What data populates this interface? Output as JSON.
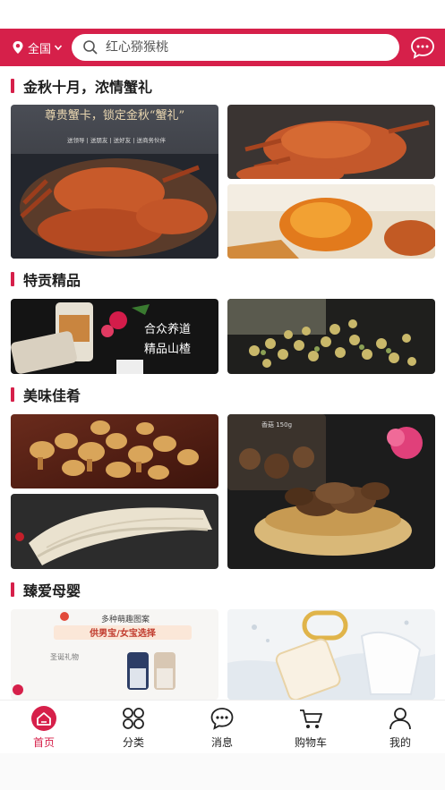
{
  "header": {
    "location_label": "全国",
    "search_placeholder": "红心猕猴桃"
  },
  "sections": [
    {
      "title": "金秋十月，浓情蟹礼",
      "banner_headline": "尊贵蟹卡，锁定金秋“蟹礼”",
      "banner_tags": "送领导 | 送朋友 | 送好友 | 送商务伙伴"
    },
    {
      "title": "特贡精品",
      "banner_line1": "合众养道",
      "banner_line2": "精品山楂"
    },
    {
      "title": "美味佳肴",
      "jar_label": "香菇 150g"
    },
    {
      "title": "臻爱母婴",
      "banner_line1": "多种萌趣图案",
      "banner_line2": "供男宝/女宝选择",
      "banner_line3": "圣诞礼物"
    }
  ],
  "tabbar": {
    "items": [
      {
        "label": "首页",
        "icon": "home-icon",
        "active": true
      },
      {
        "label": "分类",
        "icon": "grid-icon",
        "active": false
      },
      {
        "label": "消息",
        "icon": "chat-icon",
        "active": false
      },
      {
        "label": "购物车",
        "icon": "cart-icon",
        "active": false
      },
      {
        "label": "我的",
        "icon": "user-icon",
        "active": false
      }
    ]
  },
  "colors": {
    "brand": "#d6204a",
    "tab_active": "#d6204a"
  }
}
